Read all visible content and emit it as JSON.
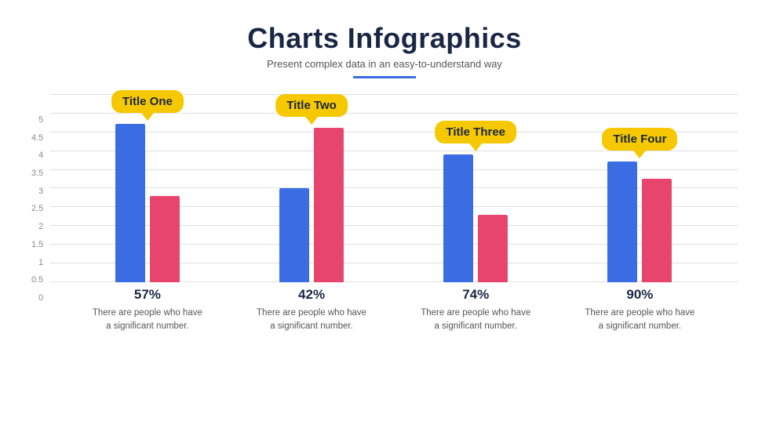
{
  "header": {
    "title": "Charts Infographics",
    "subtitle": "Present complex data in an easy-to-understand way"
  },
  "yAxis": {
    "labels": [
      "0",
      "0.5",
      "1",
      "1.5",
      "2",
      "2.5",
      "3",
      "3.5",
      "4",
      "4.5",
      "5"
    ]
  },
  "groups": [
    {
      "bubbleLabel": "Title One",
      "blueHeight": 200,
      "pinkHeight": 145,
      "bubbleTop": -38,
      "bubbleLeft": -30,
      "percentage": "57%",
      "description": "There are people who have\na significant number."
    },
    {
      "bubbleLabel": "Title Two",
      "blueHeight": 165,
      "pinkHeight": 195,
      "bubbleTop": -38,
      "bubbleLeft": -30,
      "percentage": "42%",
      "description": "There are people who have\na significant number."
    },
    {
      "bubbleLabel": "Title Three",
      "blueHeight": 230,
      "pinkHeight": 120,
      "bubbleTop": -38,
      "bubbleLeft": -40,
      "percentage": "74%",
      "description": "There are people who have\na significant number."
    },
    {
      "bubbleLabel": "Title Four",
      "blueHeight": 210,
      "pinkHeight": 178,
      "bubbleTop": -38,
      "bubbleLeft": -25,
      "percentage": "90%",
      "description": "There are people who have\na significant number."
    }
  ]
}
